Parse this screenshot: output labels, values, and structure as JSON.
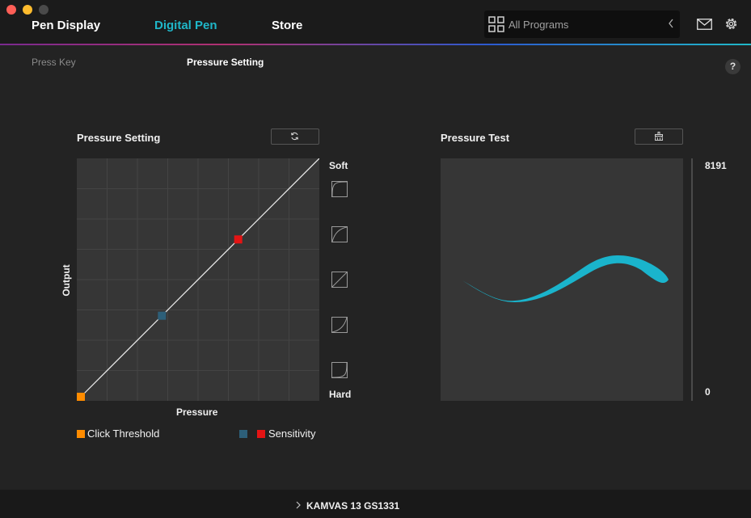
{
  "window": {
    "tabs": [
      {
        "label": "Pen Display"
      },
      {
        "label": "Digital Pen"
      },
      {
        "label": "Store"
      }
    ],
    "active_tab": "Digital Pen",
    "program_select": {
      "value": "All Programs",
      "icon": "grid-icon"
    },
    "icons": {
      "mail": "mail-icon",
      "settings": "gear-icon"
    },
    "accent_color": "#1fb7c9"
  },
  "subtabs": [
    {
      "label": "Press Key"
    },
    {
      "label": "Pressure Setting"
    }
  ],
  "help": {
    "label": "?"
  },
  "pressure_setting": {
    "title": "Pressure Setting",
    "reset_icon": "refresh-icon",
    "output_label": "Output",
    "pressure_label": "Pressure",
    "soft_label": "Soft",
    "hard_label": "Hard",
    "presets": [
      "curve-soft-2-icon",
      "curve-soft-1-icon",
      "curve-linear-icon",
      "curve-hard-1-icon",
      "curve-hard-2-icon"
    ],
    "points": {
      "click_threshold": {
        "pressure": 0.0,
        "output": 0.0,
        "color": "#ff8c00"
      },
      "sensitivity_low": {
        "pressure": 0.34,
        "output": 0.34,
        "color": "#2d5f79"
      },
      "sensitivity_high": {
        "pressure": 0.66,
        "output": 0.66,
        "color": "#e41414"
      }
    },
    "legend": {
      "click_threshold": "Click Threshold",
      "sensitivity": "Sensitivity"
    }
  },
  "pressure_test": {
    "title": "Pressure Test",
    "clear_icon": "broom-icon",
    "max_value": "8191",
    "min_value": "0",
    "stroke_color": "#1ab4cc"
  },
  "footer": {
    "device_name": "KAMVAS 13 GS1331"
  }
}
